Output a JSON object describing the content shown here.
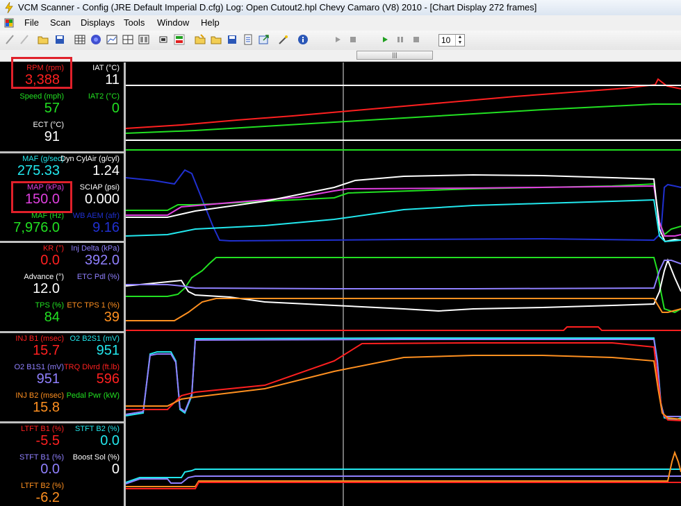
{
  "window": {
    "title": "VCM Scanner  -  Config  (JRE Default Imperial D.cfg)    Log:  Open Cutout2.hpl    Chevy Camaro (V8) 2010  -  [Chart Display   272 frames]"
  },
  "menu": [
    "File",
    "Scan",
    "Displays",
    "Tools",
    "Window",
    "Help"
  ],
  "toolbar": {
    "frames_value": "10"
  },
  "colors": {
    "red": "#ff2020",
    "green": "#22e022",
    "white": "#ffffff",
    "cyan": "#22e8ee",
    "magenta": "#e040e0",
    "blue": "#2030d0",
    "purple": "#9080ff",
    "orange": "#ff9020"
  },
  "panels": [
    {
      "params": [
        {
          "label": "RPM (rpm)",
          "value": "3,388",
          "color": "#ff2020"
        },
        {
          "label": "IAT (°C)",
          "value": "11",
          "color": "#ffffff"
        },
        {
          "label": "Speed (mph)",
          "value": "57",
          "color": "#22e022"
        },
        {
          "label": "IAT2 (°C)",
          "value": "0",
          "color": "#22e022"
        },
        {
          "label": "ECT (°C)",
          "value": "91",
          "color": "#ffffff"
        }
      ]
    },
    {
      "params": [
        {
          "label": "MAF (g/sec)",
          "value": "275.33",
          "color": "#22e8ee"
        },
        {
          "label": "Dyn CylAir (g/cyl)",
          "value": "1.24",
          "color": "#ffffff"
        },
        {
          "label": "MAP (kPa)",
          "value": "150.0",
          "color": "#e040e0"
        },
        {
          "label": "SCIAP (psi)",
          "value": "0.000",
          "color": "#ffffff"
        },
        {
          "label": "MAF (Hz)",
          "value": "7,976.0",
          "color": "#22e022"
        },
        {
          "label": "WB AEM (afr)",
          "value": "9.16",
          "color": "#2030d0"
        }
      ]
    },
    {
      "params": [
        {
          "label": "KR (°)",
          "value": "0.0",
          "color": "#ff2020"
        },
        {
          "label": "Inj Delta (kPa)",
          "value": "392.0",
          "color": "#9080ff"
        },
        {
          "label": "Advance (°)",
          "value": "12.0",
          "color": "#ffffff"
        },
        {
          "label": "ETC Pdl (%)",
          "value": "",
          "color": "#9080ff"
        },
        {
          "label": "TPS (%)",
          "value": "84",
          "color": "#22e022"
        },
        {
          "label": "ETC TPS 1 (%)",
          "value": "39",
          "color": "#ff9020"
        }
      ]
    },
    {
      "params": [
        {
          "label": "INJ B1 (msec)",
          "value": "15.7",
          "color": "#ff2020"
        },
        {
          "label": "O2 B2S1 (mV)",
          "value": "951",
          "color": "#22e8ee"
        },
        {
          "label": "O2 B1S1 (mV)",
          "value": "951",
          "color": "#9080ff"
        },
        {
          "label": "TRQ Dlvrd (ft.lb)",
          "value": "596",
          "color": "#ff2020"
        },
        {
          "label": "INJ B2 (msec)",
          "value": "15.8",
          "color": "#ff9020"
        },
        {
          "label": "Pedal Pwr (kW)",
          "value": "",
          "color": "#22e022"
        }
      ]
    },
    {
      "params": [
        {
          "label": "LTFT B1 (%)",
          "value": "-5.5",
          "color": "#ff2020"
        },
        {
          "label": "STFT B2 (%)",
          "value": "0.0",
          "color": "#22e8ee"
        },
        {
          "label": "STFT B1 (%)",
          "value": "0.0",
          "color": "#9080ff"
        },
        {
          "label": "Boost Sol (%)",
          "value": "0",
          "color": "#ffffff"
        },
        {
          "label": "LTFT B2 (%)",
          "value": "-6.2",
          "color": "#ff9020"
        }
      ]
    }
  ]
}
